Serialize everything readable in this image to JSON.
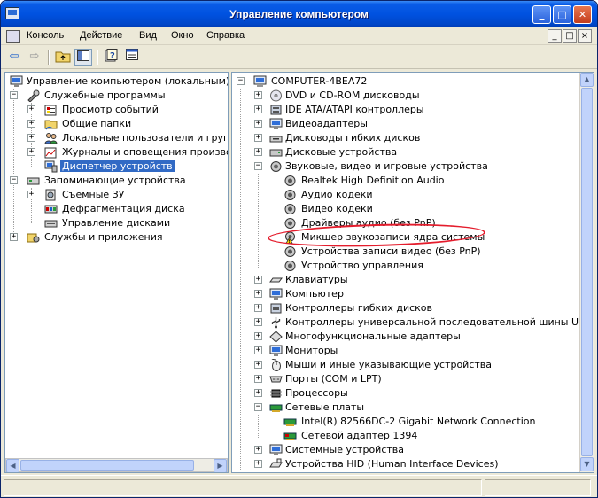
{
  "window": {
    "title": "Управление компьютером",
    "minimize_glyph": "_",
    "maximize_glyph": "□",
    "close_glyph": "✕"
  },
  "menu": {
    "items": [
      "Консоль",
      "Действие",
      "Вид",
      "Окно",
      "Справка"
    ],
    "mdi_min": "_",
    "mdi_restore": "□",
    "mdi_close": "×"
  },
  "toolbar": {
    "icons": [
      "back-arrow-icon",
      "forward-arrow-icon",
      "up-folder-icon",
      "show-hide-tree-icon",
      "help-icon",
      "properties-icon"
    ]
  },
  "left_tree": {
    "root": "Управление компьютером (локальным)",
    "sys_tools": "Служебные программы",
    "event_viewer": "Просмотр событий",
    "shared_folders": "Общие папки",
    "local_users": "Локальные пользователи и группы",
    "perf_logs": "Журналы и оповещения производит",
    "device_manager": "Диспетчер устройств",
    "storage": "Запоминающие устройства",
    "removable": "Съемные ЗУ",
    "defrag": "Дефрагментация диска",
    "disk_mgmt": "Управление дисками",
    "services": "Службы и приложения"
  },
  "device_tree": {
    "computer": "COMPUTER-4BEA72",
    "dvd": "DVD и CD-ROM дисководы",
    "ide": "IDE ATA/ATAPI контроллеры",
    "video": "Видеоадаптеры",
    "floppy_drives": "Дисководы гибких дисков",
    "disk_drives": "Дисковые устройства",
    "sound": "Звуковые, видео и игровые устройства",
    "sound_children": {
      "realtek": "Realtek High Definition Audio",
      "audio_codecs": "Аудио кодеки",
      "video_codecs": "Видео кодеки",
      "legacy_audio": "Драйверы аудио (без PnP)",
      "kmixer": "Микшер звукозаписи ядра системы",
      "video_capture": "Устройства записи видео (без PnP)",
      "media_control": "Устройство управления"
    },
    "keyboards": "Клавиатуры",
    "computer_node": "Компьютер",
    "floppy_ctrl": "Контроллеры гибких дисков",
    "usb": "Контроллеры универсальной последовательной шины USB",
    "multifunction": "Многофункциональные адаптеры",
    "monitors": "Мониторы",
    "mice": "Мыши и иные указывающие устройства",
    "ports": "Порты (COM и LPT)",
    "cpu": "Процессоры",
    "network": "Сетевые платы",
    "network_children": {
      "intel": "Intel(R) 82566DC-2 Gigabit Network Connection",
      "adapter1394": "Сетевой адаптер 1394"
    },
    "system": "Системные устройства",
    "hid": "Устройства HID (Human Interface Devices)"
  },
  "annotation": {
    "color": "#e41c2c",
    "highlighted_item": "Микшер звукозаписи ядра системы"
  },
  "colors": {
    "title_bar": "#0052e0",
    "selection": "#316ac5",
    "warning": "#f5d300"
  }
}
